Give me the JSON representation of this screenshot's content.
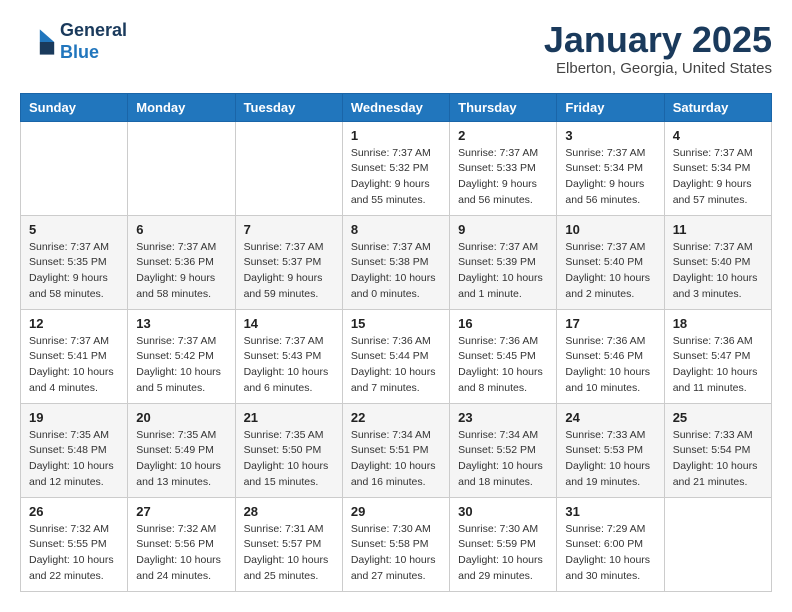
{
  "header": {
    "logo_line1": "General",
    "logo_line2": "Blue",
    "month": "January 2025",
    "location": "Elberton, Georgia, United States"
  },
  "weekdays": [
    "Sunday",
    "Monday",
    "Tuesday",
    "Wednesday",
    "Thursday",
    "Friday",
    "Saturday"
  ],
  "weeks": [
    [
      {
        "day": "",
        "info": ""
      },
      {
        "day": "",
        "info": ""
      },
      {
        "day": "",
        "info": ""
      },
      {
        "day": "1",
        "info": "Sunrise: 7:37 AM\nSunset: 5:32 PM\nDaylight: 9 hours\nand 55 minutes."
      },
      {
        "day": "2",
        "info": "Sunrise: 7:37 AM\nSunset: 5:33 PM\nDaylight: 9 hours\nand 56 minutes."
      },
      {
        "day": "3",
        "info": "Sunrise: 7:37 AM\nSunset: 5:34 PM\nDaylight: 9 hours\nand 56 minutes."
      },
      {
        "day": "4",
        "info": "Sunrise: 7:37 AM\nSunset: 5:34 PM\nDaylight: 9 hours\nand 57 minutes."
      }
    ],
    [
      {
        "day": "5",
        "info": "Sunrise: 7:37 AM\nSunset: 5:35 PM\nDaylight: 9 hours\nand 58 minutes."
      },
      {
        "day": "6",
        "info": "Sunrise: 7:37 AM\nSunset: 5:36 PM\nDaylight: 9 hours\nand 58 minutes."
      },
      {
        "day": "7",
        "info": "Sunrise: 7:37 AM\nSunset: 5:37 PM\nDaylight: 9 hours\nand 59 minutes."
      },
      {
        "day": "8",
        "info": "Sunrise: 7:37 AM\nSunset: 5:38 PM\nDaylight: 10 hours\nand 0 minutes."
      },
      {
        "day": "9",
        "info": "Sunrise: 7:37 AM\nSunset: 5:39 PM\nDaylight: 10 hours\nand 1 minute."
      },
      {
        "day": "10",
        "info": "Sunrise: 7:37 AM\nSunset: 5:40 PM\nDaylight: 10 hours\nand 2 minutes."
      },
      {
        "day": "11",
        "info": "Sunrise: 7:37 AM\nSunset: 5:40 PM\nDaylight: 10 hours\nand 3 minutes."
      }
    ],
    [
      {
        "day": "12",
        "info": "Sunrise: 7:37 AM\nSunset: 5:41 PM\nDaylight: 10 hours\nand 4 minutes."
      },
      {
        "day": "13",
        "info": "Sunrise: 7:37 AM\nSunset: 5:42 PM\nDaylight: 10 hours\nand 5 minutes."
      },
      {
        "day": "14",
        "info": "Sunrise: 7:37 AM\nSunset: 5:43 PM\nDaylight: 10 hours\nand 6 minutes."
      },
      {
        "day": "15",
        "info": "Sunrise: 7:36 AM\nSunset: 5:44 PM\nDaylight: 10 hours\nand 7 minutes."
      },
      {
        "day": "16",
        "info": "Sunrise: 7:36 AM\nSunset: 5:45 PM\nDaylight: 10 hours\nand 8 minutes."
      },
      {
        "day": "17",
        "info": "Sunrise: 7:36 AM\nSunset: 5:46 PM\nDaylight: 10 hours\nand 10 minutes."
      },
      {
        "day": "18",
        "info": "Sunrise: 7:36 AM\nSunset: 5:47 PM\nDaylight: 10 hours\nand 11 minutes."
      }
    ],
    [
      {
        "day": "19",
        "info": "Sunrise: 7:35 AM\nSunset: 5:48 PM\nDaylight: 10 hours\nand 12 minutes."
      },
      {
        "day": "20",
        "info": "Sunrise: 7:35 AM\nSunset: 5:49 PM\nDaylight: 10 hours\nand 13 minutes."
      },
      {
        "day": "21",
        "info": "Sunrise: 7:35 AM\nSunset: 5:50 PM\nDaylight: 10 hours\nand 15 minutes."
      },
      {
        "day": "22",
        "info": "Sunrise: 7:34 AM\nSunset: 5:51 PM\nDaylight: 10 hours\nand 16 minutes."
      },
      {
        "day": "23",
        "info": "Sunrise: 7:34 AM\nSunset: 5:52 PM\nDaylight: 10 hours\nand 18 minutes."
      },
      {
        "day": "24",
        "info": "Sunrise: 7:33 AM\nSunset: 5:53 PM\nDaylight: 10 hours\nand 19 minutes."
      },
      {
        "day": "25",
        "info": "Sunrise: 7:33 AM\nSunset: 5:54 PM\nDaylight: 10 hours\nand 21 minutes."
      }
    ],
    [
      {
        "day": "26",
        "info": "Sunrise: 7:32 AM\nSunset: 5:55 PM\nDaylight: 10 hours\nand 22 minutes."
      },
      {
        "day": "27",
        "info": "Sunrise: 7:32 AM\nSunset: 5:56 PM\nDaylight: 10 hours\nand 24 minutes."
      },
      {
        "day": "28",
        "info": "Sunrise: 7:31 AM\nSunset: 5:57 PM\nDaylight: 10 hours\nand 25 minutes."
      },
      {
        "day": "29",
        "info": "Sunrise: 7:30 AM\nSunset: 5:58 PM\nDaylight: 10 hours\nand 27 minutes."
      },
      {
        "day": "30",
        "info": "Sunrise: 7:30 AM\nSunset: 5:59 PM\nDaylight: 10 hours\nand 29 minutes."
      },
      {
        "day": "31",
        "info": "Sunrise: 7:29 AM\nSunset: 6:00 PM\nDaylight: 10 hours\nand 30 minutes."
      },
      {
        "day": "",
        "info": ""
      }
    ]
  ]
}
